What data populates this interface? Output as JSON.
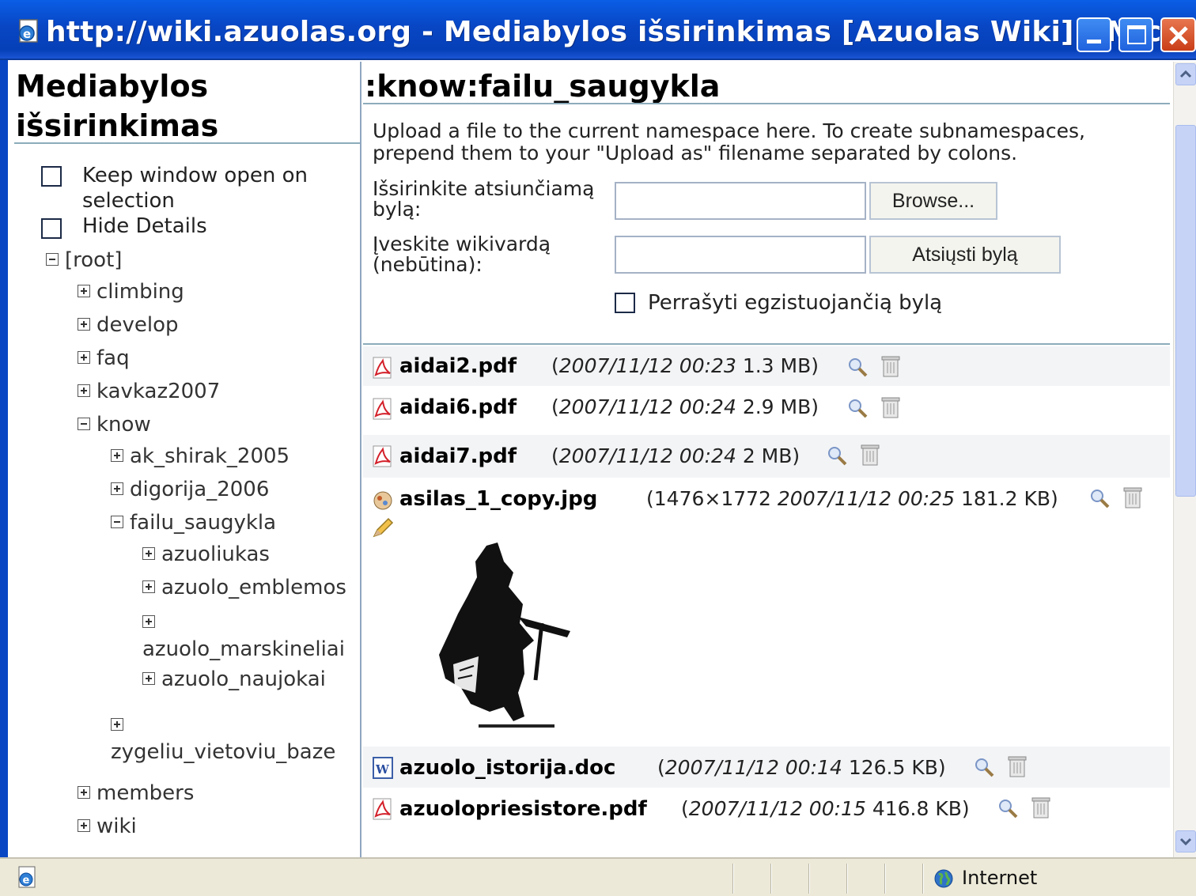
{
  "window": {
    "title": "http://wiki.azuolas.org - Mediabylos išsirinkimas [Azuolas Wiki] - Micr...",
    "buttons": {
      "minimize": "minimize",
      "maximize": "maximize",
      "close": "close"
    }
  },
  "sidebar": {
    "title": "Mediabylos išsirinkimas",
    "options": [
      {
        "label": "Keep window open on selection",
        "checked": false
      },
      {
        "label": "Hide Details",
        "checked": false
      }
    ],
    "tree": [
      {
        "label": "[root]",
        "expanded": true
      },
      {
        "label": "climbing",
        "expanded": false
      },
      {
        "label": "develop",
        "expanded": false
      },
      {
        "label": "faq",
        "expanded": false
      },
      {
        "label": "kavkaz2007",
        "expanded": false
      },
      {
        "label": "know",
        "expanded": true
      },
      {
        "label": "ak_shirak_2005",
        "expanded": false
      },
      {
        "label": "digorija_2006",
        "expanded": false
      },
      {
        "label": "failu_saugykla",
        "expanded": true
      },
      {
        "label": "azuoliukas",
        "expanded": false
      },
      {
        "label": "azuolo_emblemos",
        "expanded": false
      },
      {
        "label": "azuolo_marskineliai",
        "expanded": false
      },
      {
        "label": "azuolo_naujokai",
        "expanded": false
      },
      {
        "label": "zygeliu_vietoviu_baze",
        "expanded": false
      },
      {
        "label": "members",
        "expanded": false
      },
      {
        "label": "wiki",
        "expanded": false
      }
    ]
  },
  "main": {
    "namespace": ":know:failu_saugykla",
    "upload": {
      "help": "Upload a file to the current namespace here. To create subnamespaces, prepend them to your \"Upload as\" filename separated by colons.",
      "file_label": "Išsirinkite atsiunčiamą bylą:",
      "browse_label": "Browse...",
      "name_label": "Įveskite wikivardą (nebūtina):",
      "submit_label": "Atsiųsti bylą",
      "overwrite_label": "Perrašyti egzistuojančią bylą",
      "overwrite_checked": false
    },
    "files": [
      {
        "name": "aidai2.pdf",
        "type": "pdf",
        "date": "2007/11/12 00:23",
        "size": "1.3 MB)",
        "dims": ""
      },
      {
        "name": "aidai6.pdf",
        "type": "pdf",
        "date": "2007/11/12 00:24",
        "size": "2.9 MB)",
        "dims": ""
      },
      {
        "name": "aidai7.pdf",
        "type": "pdf",
        "date": "2007/11/12 00:24",
        "size": "2 MB)",
        "dims": ""
      },
      {
        "name": "asilas_1_copy.jpg",
        "type": "jpg",
        "date": "2007/11/12 00:25",
        "size": "181.2 KB)",
        "dims": "(1476×1772 "
      },
      {
        "name": "azuolo_istorija.doc",
        "type": "doc",
        "date": "2007/11/12 00:14",
        "size": "126.5 KB)",
        "dims": ""
      },
      {
        "name": "azuolopriesistore.pdf",
        "type": "pdf",
        "date": "2007/11/12 00:15",
        "size": "416.8 KB)",
        "dims": ""
      }
    ]
  },
  "status": {
    "zone": "Internet"
  },
  "colors": {
    "titlebar": "#0846c4",
    "rule": "#8cacbb",
    "statusbar": "#ece9d8",
    "row_alt": "#f3f4f6"
  }
}
